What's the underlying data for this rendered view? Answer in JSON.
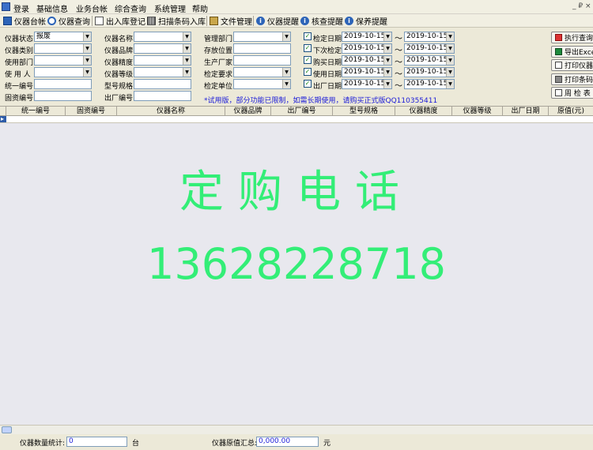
{
  "menu": {
    "items": [
      "登录",
      "基础信息",
      "业务台帐",
      "综合查询",
      "系统管理",
      "帮助"
    ],
    "window_controls": "_ ₽ ×"
  },
  "toolbar": {
    "items": [
      "仪器台帐",
      "仪器查询",
      "出入库登记",
      "扫描条码入库",
      "文件管理",
      "仪器提醒",
      "核查提醒",
      "保养提醒"
    ]
  },
  "filters": {
    "col1": [
      {
        "label": "仪器状态",
        "value": "报废"
      },
      {
        "label": "仪器类别",
        "value": ""
      },
      {
        "label": "使用部门",
        "value": ""
      },
      {
        "label": "使 用 人",
        "value": ""
      },
      {
        "label": "统一编号",
        "value": ""
      },
      {
        "label": "固资编号",
        "value": ""
      }
    ],
    "col2": [
      {
        "label": "仪器名称",
        "value": ""
      },
      {
        "label": "仪器品牌",
        "value": ""
      },
      {
        "label": "仪器精度",
        "value": ""
      },
      {
        "label": "仪器等级",
        "value": ""
      },
      {
        "label": "型号规格",
        "value": ""
      },
      {
        "label": "出厂编号",
        "value": ""
      }
    ],
    "col3": [
      {
        "label": "管理部门",
        "value": ""
      },
      {
        "label": "存放位置",
        "value": ""
      },
      {
        "label": "生产厂家",
        "value": ""
      },
      {
        "label": "检定要求",
        "value": ""
      },
      {
        "label": "检定单位",
        "value": ""
      }
    ],
    "dates": [
      {
        "label": "检定日期",
        "from": "2019-10-15",
        "to": "2019-10-15"
      },
      {
        "label": "下次检定",
        "from": "2019-10-15",
        "to": "2019-10-15"
      },
      {
        "label": "购买日期",
        "from": "2019-10-15",
        "to": "2019-10-15"
      },
      {
        "label": "使用日期",
        "from": "2019-10-15",
        "to": "2019-10-15"
      },
      {
        "label": "出厂日期",
        "from": "2019-10-15",
        "to": "2019-10-15"
      }
    ],
    "tilde": "～",
    "check_mark": "✓",
    "notice": "*试用版，部分功能已限制，如需长期使用，请购买正式版QQ110355411"
  },
  "actions": [
    "执行查询",
    "导出Excel",
    "打印仪器",
    "打印条码",
    "周 检 表"
  ],
  "grid": {
    "columns": [
      "统一编号",
      "固资编号",
      "仪器名称",
      "仪器品牌",
      "出厂编号",
      "型号规格",
      "仪器精度",
      "仪器等级",
      "出厂日期",
      "原值(元)"
    ],
    "row_marker": "▸"
  },
  "promo": {
    "line1": "定购电话",
    "line2": "13628228718"
  },
  "status": {
    "count_label": "仪器数量统计:",
    "count_value": "0",
    "count_unit": "台",
    "total_label": "仪器原值汇总:",
    "total_value": "0,000.00",
    "total_unit": "元"
  },
  "colors": {
    "promo_text": "#33EE77",
    "notice_text": "#1A1AD8",
    "grid_body": "#E8E8EE"
  }
}
